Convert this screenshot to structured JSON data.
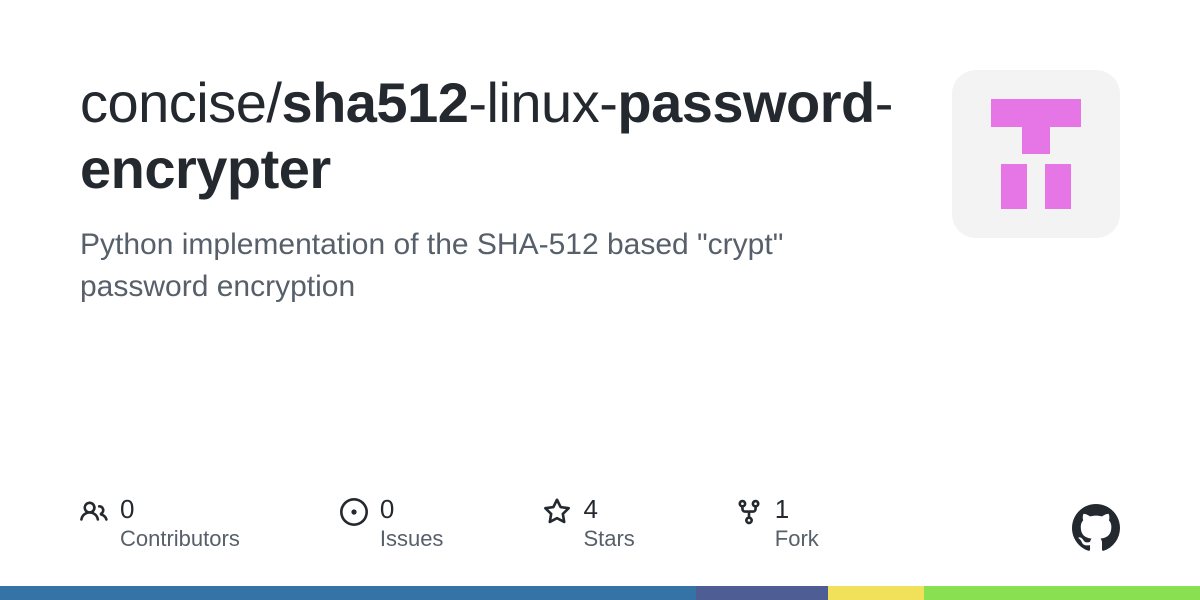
{
  "repo": {
    "owner": "concise",
    "slash": "/",
    "name_parts": [
      "sha512",
      "-",
      "linux",
      "-",
      "password",
      "-",
      "encrypter"
    ]
  },
  "description": "Python implementation of the SHA-512 based \"crypt\" password encryption",
  "stats": {
    "contributors": {
      "count": "0",
      "label": "Contributors"
    },
    "issues": {
      "count": "0",
      "label": "Issues"
    },
    "stars": {
      "count": "4",
      "label": "Stars"
    },
    "forks": {
      "count": "1",
      "label": "Fork"
    }
  }
}
